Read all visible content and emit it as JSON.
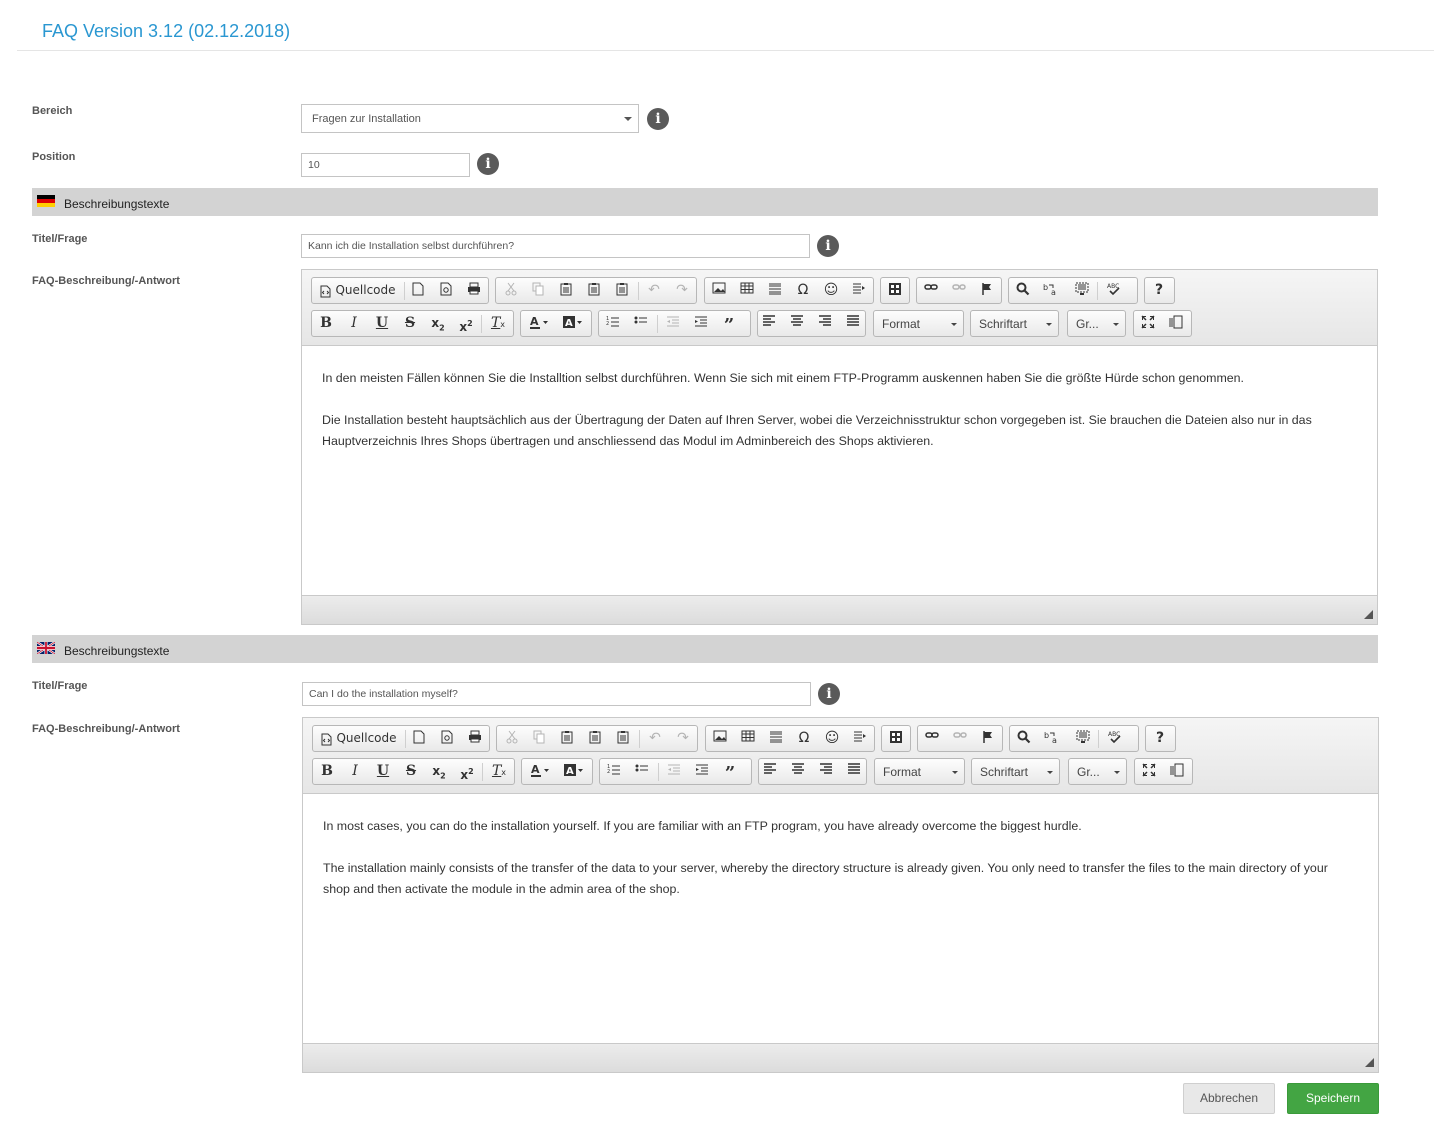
{
  "page": {
    "title": "FAQ Version 3.12 (02.12.2018)"
  },
  "form": {
    "bereich_label": "Bereich",
    "bereich_value": "Fragen zur Installation",
    "position_label": "Position",
    "position_value": "10",
    "info_glyph": "i"
  },
  "sections": [
    {
      "language": "de",
      "flag": "germany-flag-icon",
      "header": "Beschreibungstexte",
      "title_label": "Titel/Frage",
      "title_value": "Kann ich die Installation selbst durchführen?",
      "desc_label": "FAQ-Beschreibung/-Antwort",
      "paragraphs": [
        "In den meisten Fällen können Sie die Installtion selbst durchführen. Wenn Sie sich mit einem FTP-Programm auskennen haben Sie die größte Hürde schon genommen.",
        "Die Installation besteht hauptsächlich aus der Übertragung der Daten auf Ihren Server, wobei die Verzeichnisstruktur schon vorgegeben ist. Sie brauchen die Dateien also nur in das Hauptverzeichnis Ihres Shops übertragen und anschliessend das Modul im Adminbereich des Shops aktivieren."
      ]
    },
    {
      "language": "en",
      "flag": "uk-flag-icon",
      "header": "Beschreibungstexte",
      "title_label": "Titel/Frage",
      "title_value": "Can I do the installation myself?",
      "desc_label": "FAQ-Beschreibung/-Antwort",
      "paragraphs": [
        "In most cases, you can do the installation yourself. If you are familiar with an FTP program, you have already overcome the biggest hurdle.",
        "The installation mainly consists of the transfer of the data to your server, whereby the directory structure is already given. You only need to transfer the files to the main directory of your shop and then activate the module in the admin area of the shop."
      ]
    }
  ],
  "editor_toolbar": {
    "source_label": "Quellcode",
    "format_label": "Format",
    "font_label": "Schriftart",
    "size_label": "Gr...",
    "help_glyph": "?",
    "omega_glyph": "Ω",
    "smiley_glyph": "☺",
    "quote_glyph": "”",
    "undo_glyph": "↶",
    "redo_glyph": "↷"
  },
  "actions": {
    "cancel_label": "Abbrechen",
    "save_label": "Speichern"
  },
  "colors": {
    "accent": "#2a97d1",
    "save_green": "#43a543",
    "section_bar": "#d3d3d3"
  }
}
